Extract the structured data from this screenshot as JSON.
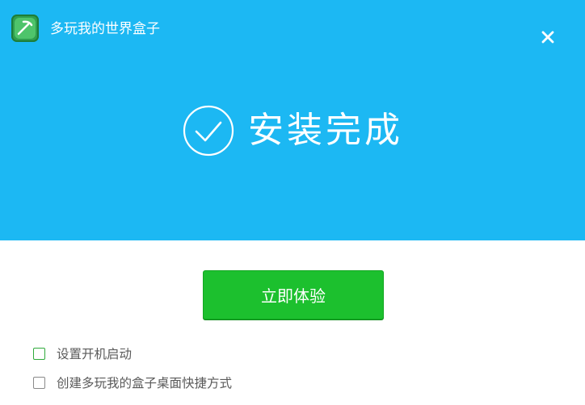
{
  "window": {
    "title": "多玩我的世界盒子",
    "logo_icon": "pickaxe-icon",
    "close_icon": "close-icon"
  },
  "status": {
    "icon": "check-circle-icon",
    "text": "安装完成"
  },
  "actions": {
    "primary_label": "立即体验"
  },
  "options": [
    {
      "label": "设置开机启动",
      "checked": false,
      "border_color": "#2faa3b"
    },
    {
      "label": "创建多玩我的盒子桌面快捷方式",
      "checked": false,
      "border_color": "#8a8a8a"
    }
  ],
  "colors": {
    "hero_bg": "#1cb8f3",
    "primary_button": "#1cc02e",
    "logo_bg": "#2f9e4f"
  }
}
